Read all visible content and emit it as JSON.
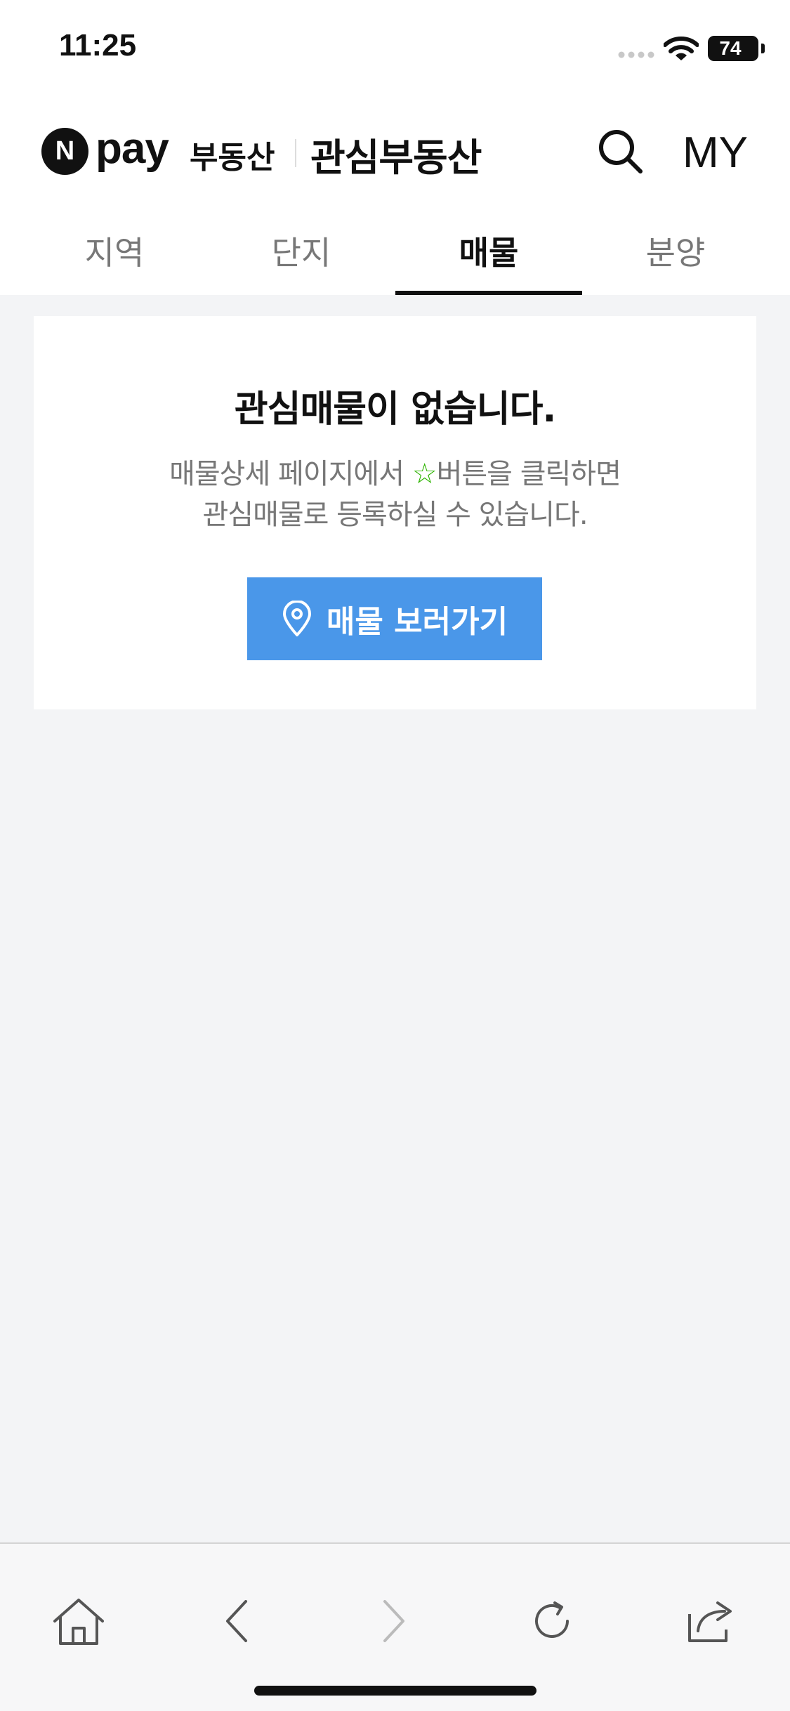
{
  "status_bar": {
    "time": "11:25",
    "battery": "74"
  },
  "header": {
    "logo_n": "N",
    "logo_pay": "pay",
    "logo_service": "부동산",
    "title": "관심부동산",
    "my_label": "MY",
    "icons": {
      "search": "search-icon"
    }
  },
  "tabs": [
    {
      "label": "지역",
      "active": false
    },
    {
      "label": "단지",
      "active": false
    },
    {
      "label": "매물",
      "active": true
    },
    {
      "label": "분양",
      "active": false
    }
  ],
  "empty_state": {
    "title": "관심매물이 없습니다.",
    "desc_part1": "매물상세 페이지에서 ",
    "star": "☆",
    "desc_part2": "버튼을 클릭하면",
    "desc_line2": "관심매물로 등록하실 수 있습니다.",
    "button_label": "매물 보러가기"
  },
  "colors": {
    "accent_button": "#4a97e9",
    "star": "#2db400",
    "background": "#f3f4f6"
  },
  "toolbar": {
    "icons": [
      "home-icon",
      "back-icon",
      "forward-icon",
      "reload-icon",
      "share-icon"
    ]
  }
}
